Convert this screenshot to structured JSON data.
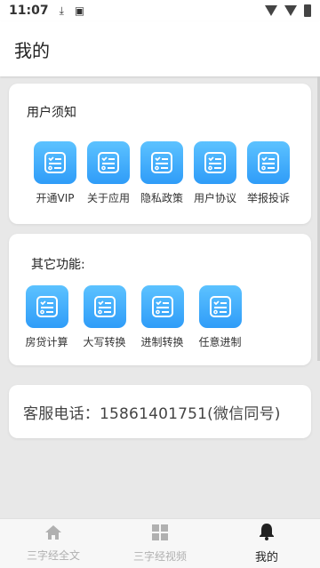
{
  "status_bar": {
    "time": "11:07"
  },
  "header": {
    "title": "我的"
  },
  "notice_section": {
    "title": "用户须知",
    "items": [
      {
        "label": "开通VIP"
      },
      {
        "label": "关于应用"
      },
      {
        "label": "隐私政策"
      },
      {
        "label": "用户协议"
      },
      {
        "label": "举报投诉"
      }
    ]
  },
  "functions_section": {
    "title": "其它功能:",
    "items": [
      {
        "label": "房贷计算"
      },
      {
        "label": "大写转换"
      },
      {
        "label": "进制转换"
      },
      {
        "label": "任意进制"
      }
    ]
  },
  "contact": {
    "phone_text": "客服电话：15861401751(微信同号)"
  },
  "bottom_nav": {
    "items": [
      {
        "label": "三字经全文",
        "icon": "home-icon",
        "active": false
      },
      {
        "label": "三字经视频",
        "icon": "grid-icon",
        "active": false
      },
      {
        "label": "我的",
        "icon": "bell-icon",
        "active": true
      }
    ]
  },
  "colors": {
    "tile_start": "#5cc2ff",
    "tile_end": "#2f9cf8",
    "inactive_nav": "#b0b0b0"
  }
}
